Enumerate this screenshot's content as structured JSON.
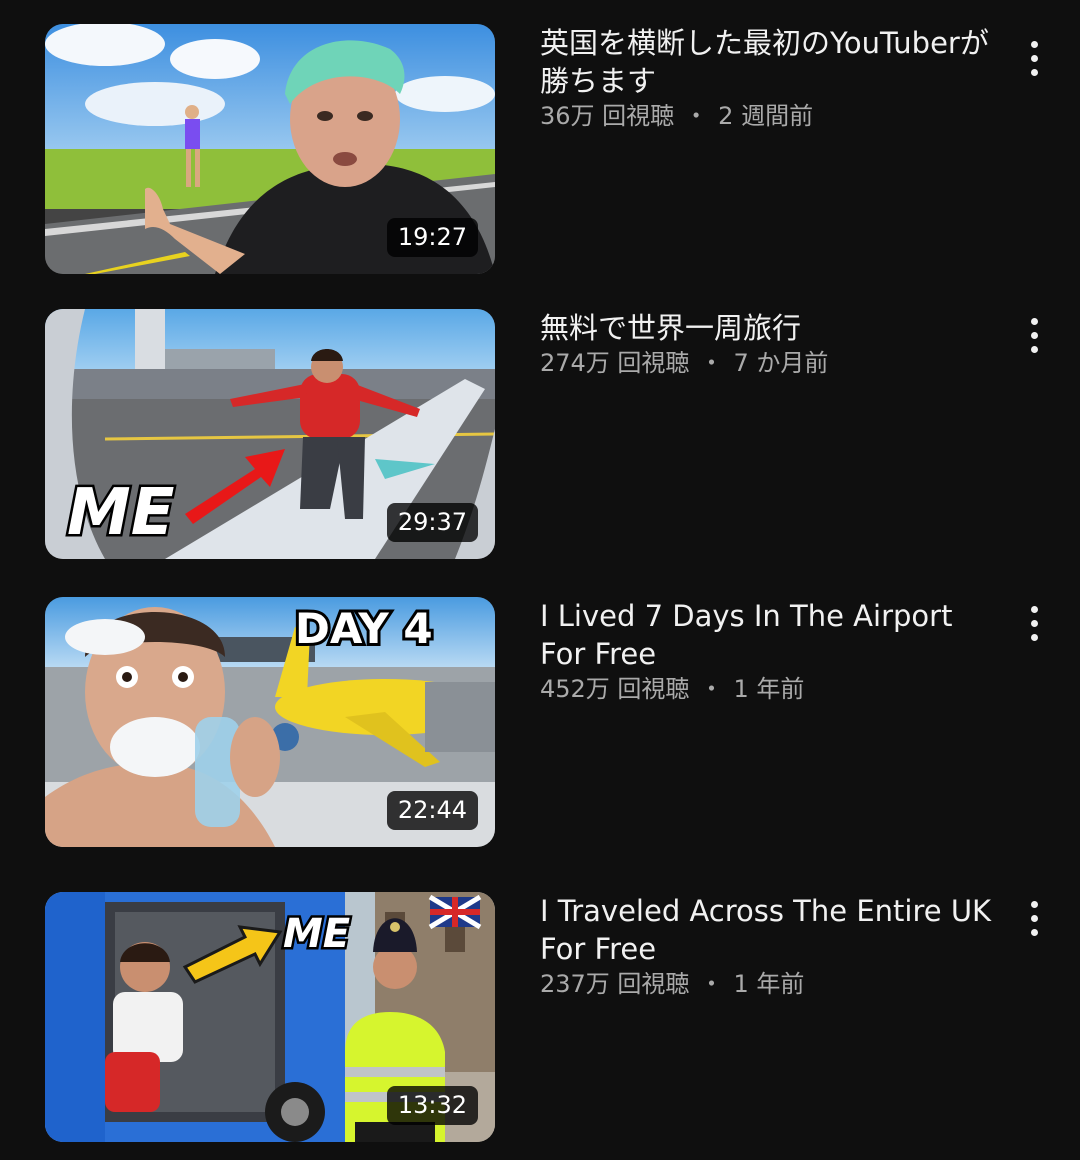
{
  "videos": [
    {
      "title": "英国を横断した最初のYouTuberが勝ちます",
      "views": "36万 回視聴",
      "age": "2 週間前",
      "duration": "19:27",
      "thumbnail_text": ""
    },
    {
      "title": "無料で世界一周旅行",
      "views": "274万 回視聴",
      "age": "7 か月前",
      "duration": "29:37",
      "thumbnail_text": "ME"
    },
    {
      "title": "I Lived 7 Days In The Airport For Free",
      "views": "452万 回視聴",
      "age": "1 年前",
      "duration": "22:44",
      "thumbnail_text": "DAY 4"
    },
    {
      "title": "I Traveled Across The Entire UK For Free",
      "views": "237万 回視聴",
      "age": "1 年前",
      "duration": "13:32",
      "thumbnail_text": "ME"
    }
  ],
  "separator": "・",
  "icons": {
    "more": "more-vert-icon"
  },
  "colors": {
    "background": "#0f0f0f",
    "title": "#f1f1f1",
    "secondary": "#aaaaaa"
  }
}
